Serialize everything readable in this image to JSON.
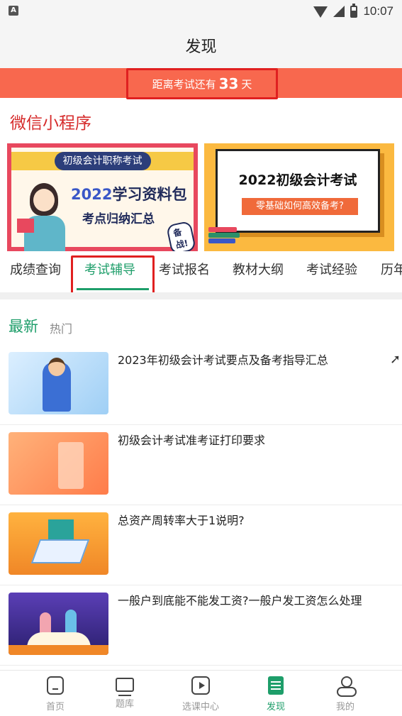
{
  "status_bar": {
    "time": "10:07",
    "left_icon": "A"
  },
  "header": {
    "title": "发现"
  },
  "countdown": {
    "prefix": "距离考试还有",
    "days": "33",
    "suffix": "天"
  },
  "mini_program": {
    "title": "微信小程序",
    "card_left": {
      "ribbon": "初级会计职称考试",
      "title_year": "2022",
      "title_rest": "学习资料包",
      "subtitle": "考点归纳汇总",
      "tag": "备战!"
    },
    "card_right": {
      "title": "2022初级会计考试",
      "subtitle": "零基础如何高效备考?"
    }
  },
  "category_tabs": [
    {
      "label": "成绩查询"
    },
    {
      "label": "考试辅导",
      "active": true
    },
    {
      "label": "考试报名"
    },
    {
      "label": "教材大纲"
    },
    {
      "label": "考试经验"
    },
    {
      "label": "历年"
    }
  ],
  "feed": {
    "latest_label": "最新",
    "hot_label": "热门"
  },
  "articles": [
    {
      "title": "2023年初级会计考试要点及备考指导汇总"
    },
    {
      "title": "初级会计考试准考证打印要求"
    },
    {
      "title": "总资产周转率大于1说明?"
    },
    {
      "title": "一般户到底能不能发工资?一般户发工资怎么处理"
    }
  ],
  "bottom_nav": [
    {
      "label": "首页",
      "icon": "home-icon"
    },
    {
      "label": "题库",
      "icon": "question-bank-icon"
    },
    {
      "label": "选课中心",
      "icon": "course-center-icon"
    },
    {
      "label": "发现",
      "icon": "discover-icon",
      "active": true
    },
    {
      "label": "我的",
      "icon": "profile-icon"
    }
  ],
  "colors": {
    "accent_green": "#1e9e6a",
    "banner_orange": "#f8684e",
    "highlight_red": "#e02020",
    "mini_title_red": "#d62b2b"
  }
}
